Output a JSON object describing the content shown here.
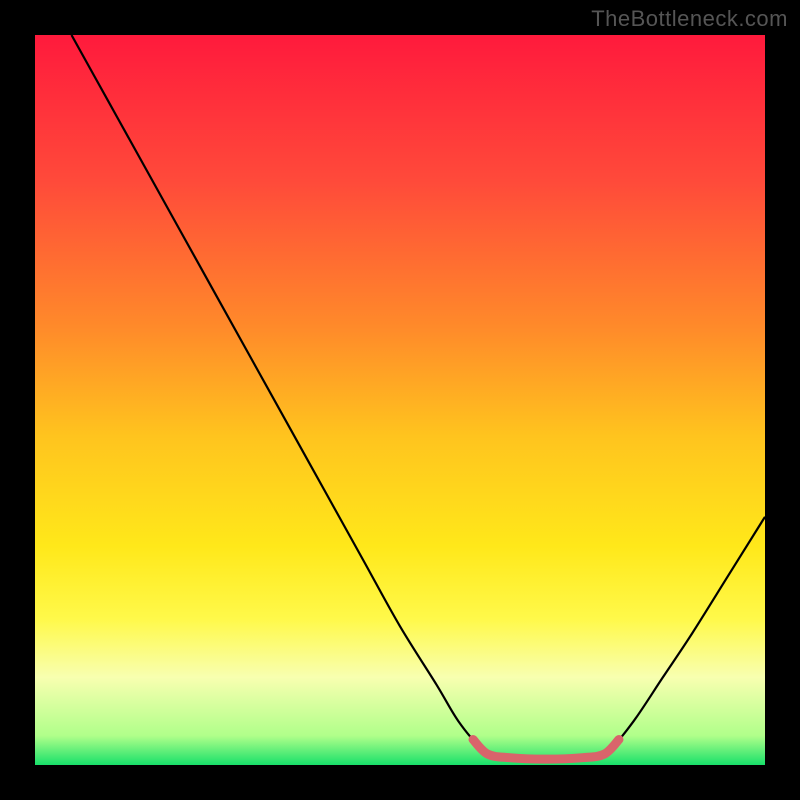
{
  "watermark": "TheBottleneck.com",
  "chart_data": {
    "type": "line",
    "title": "",
    "xlabel": "",
    "ylabel": "",
    "xlim": [
      0,
      100
    ],
    "ylim": [
      0,
      100
    ],
    "background_gradient": {
      "stops": [
        {
          "offset": 0,
          "color": "#ff1a3c"
        },
        {
          "offset": 20,
          "color": "#ff4a3a"
        },
        {
          "offset": 40,
          "color": "#ff8a2a"
        },
        {
          "offset": 55,
          "color": "#ffc41e"
        },
        {
          "offset": 70,
          "color": "#ffe81a"
        },
        {
          "offset": 80,
          "color": "#fff94a"
        },
        {
          "offset": 88,
          "color": "#f8ffb0"
        },
        {
          "offset": 96,
          "color": "#b0ff8a"
        },
        {
          "offset": 100,
          "color": "#18e06a"
        }
      ]
    },
    "series": [
      {
        "name": "bottleneck-curve",
        "stroke": "#000000",
        "stroke_width": 2.2,
        "points": [
          {
            "x": 5,
            "y": 100
          },
          {
            "x": 10,
            "y": 91
          },
          {
            "x": 15,
            "y": 82
          },
          {
            "x": 20,
            "y": 73
          },
          {
            "x": 25,
            "y": 64
          },
          {
            "x": 30,
            "y": 55
          },
          {
            "x": 35,
            "y": 46
          },
          {
            "x": 40,
            "y": 37
          },
          {
            "x": 45,
            "y": 28
          },
          {
            "x": 50,
            "y": 19
          },
          {
            "x": 55,
            "y": 11
          },
          {
            "x": 58,
            "y": 6
          },
          {
            "x": 61,
            "y": 2.5
          },
          {
            "x": 64,
            "y": 1
          },
          {
            "x": 70,
            "y": 0.8
          },
          {
            "x": 76,
            "y": 1
          },
          {
            "x": 79,
            "y": 2.5
          },
          {
            "x": 82,
            "y": 6
          },
          {
            "x": 86,
            "y": 12
          },
          {
            "x": 90,
            "y": 18
          },
          {
            "x": 95,
            "y": 26
          },
          {
            "x": 100,
            "y": 34
          }
        ]
      },
      {
        "name": "optimal-zone-marker",
        "stroke": "#d9646b",
        "stroke_width": 9,
        "points": [
          {
            "x": 60,
            "y": 3.5
          },
          {
            "x": 62,
            "y": 1.5
          },
          {
            "x": 65,
            "y": 1
          },
          {
            "x": 70,
            "y": 0.8
          },
          {
            "x": 75,
            "y": 1
          },
          {
            "x": 78,
            "y": 1.5
          },
          {
            "x": 80,
            "y": 3.5
          }
        ]
      }
    ]
  }
}
